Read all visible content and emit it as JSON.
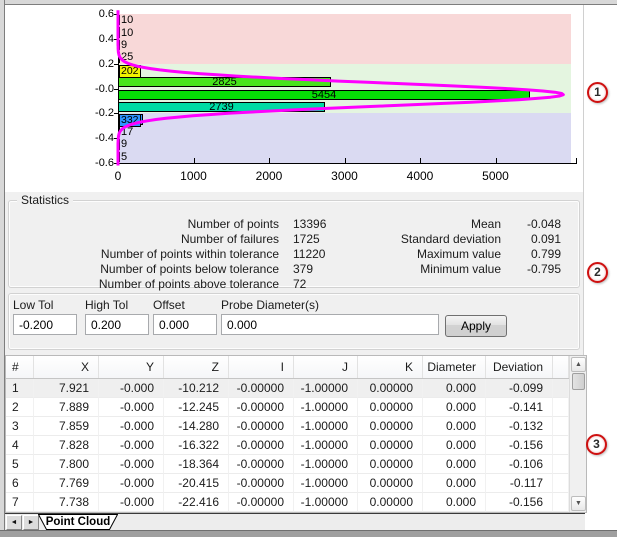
{
  "chart_data": {
    "type": "bar",
    "orientation": "horizontal-histogram",
    "title": "",
    "xlabel": "",
    "ylabel": "",
    "xlim": [
      0,
      6000
    ],
    "ylim": [
      -0.6,
      0.6
    ],
    "x_ticks": [
      0,
      1000,
      2000,
      3000,
      4000,
      5000
    ],
    "y_tick_labels": [
      "0.6",
      "0.4",
      "0.2",
      "-0.0",
      "-0.2",
      "-0.4",
      "-0.6"
    ],
    "bins": [
      {
        "range": [
          0.5,
          0.6
        ],
        "count": 10,
        "color": "#ffffff"
      },
      {
        "range": [
          0.4,
          0.5
        ],
        "count": 10,
        "color": "#ffffff"
      },
      {
        "range": [
          0.3,
          0.4
        ],
        "count": 9,
        "color": "#ffffff"
      },
      {
        "range": [
          0.2,
          0.3
        ],
        "count": 25,
        "color": "#ffffff"
      },
      {
        "range": [
          0.1,
          0.2
        ],
        "count": 202,
        "color": "#f2f200"
      },
      {
        "range": [
          0.0,
          0.1
        ],
        "count": 2825,
        "color": "#47e41c"
      },
      {
        "range": [
          -0.1,
          0.0
        ],
        "count": 5454,
        "color": "#06de06"
      },
      {
        "range": [
          -0.2,
          -0.1
        ],
        "count": 2739,
        "color": "#00dba4"
      },
      {
        "range": [
          -0.3,
          -0.2
        ],
        "count": 332,
        "color": "#2e93ff"
      },
      {
        "range": [
          -0.4,
          -0.3
        ],
        "count": 17,
        "color": "#ffffff"
      },
      {
        "range": [
          -0.5,
          -0.4
        ],
        "count": 9,
        "color": "#ffffff"
      },
      {
        "range": [
          -0.6,
          -0.5
        ],
        "count": 5,
        "color": "#ffffff"
      }
    ],
    "tolerance_bands": [
      {
        "meaning": "above-tolerance",
        "range": [
          0.2,
          0.6
        ],
        "color": "#f8d8d8"
      },
      {
        "meaning": "within-tolerance",
        "range": [
          -0.2,
          0.2
        ],
        "color": "#e4f5e0"
      },
      {
        "meaning": "below-tolerance",
        "range": [
          -0.6,
          -0.2
        ],
        "color": "#dadaf2"
      }
    ],
    "curve": {
      "shape": "gaussian",
      "mean": -0.048,
      "sigma": 0.091,
      "peak": 5900,
      "color": "#ff00ff"
    },
    "legend": null,
    "grid": false
  },
  "statistics": {
    "title": "Statistics",
    "left": [
      {
        "label": "Number of points",
        "value": "13396"
      },
      {
        "label": "Number of failures",
        "value": "1725"
      },
      {
        "label": "Number of points within tolerance",
        "value": "11220"
      },
      {
        "label": "Number of points below tolerance",
        "value": "379"
      },
      {
        "label": "Number of points above tolerance",
        "value": "72"
      }
    ],
    "right": [
      {
        "label": "Mean",
        "value": "-0.048"
      },
      {
        "label": "Standard deviation",
        "value": "0.091"
      },
      {
        "label": "Maximum value",
        "value": "0.799"
      },
      {
        "label": "Minimum value",
        "value": "-0.795"
      }
    ]
  },
  "tolerance": {
    "fields": [
      {
        "name": "low-tol",
        "label": "Low Tol",
        "value": "-0.200"
      },
      {
        "name": "high-tol",
        "label": "High Tol",
        "value": "0.200"
      },
      {
        "name": "offset",
        "label": "Offset",
        "value": "0.000"
      },
      {
        "name": "probe-diameter",
        "label": "Probe Diameter(s)",
        "value": "0.000"
      }
    ],
    "apply_label": "Apply"
  },
  "table": {
    "columns": [
      "#",
      "X",
      "Y",
      "Z",
      "I",
      "J",
      "K",
      "Diameter",
      "Deviation"
    ],
    "rows": [
      [
        "1",
        "7.921",
        "-0.000",
        "-10.212",
        "-0.00000",
        "-1.00000",
        "0.00000",
        "0.000",
        "-0.099"
      ],
      [
        "2",
        "7.889",
        "-0.000",
        "-12.245",
        "-0.00000",
        "-1.00000",
        "0.00000",
        "0.000",
        "-0.141"
      ],
      [
        "3",
        "7.859",
        "-0.000",
        "-14.280",
        "-0.00000",
        "-1.00000",
        "0.00000",
        "0.000",
        "-0.132"
      ],
      [
        "4",
        "7.828",
        "-0.000",
        "-16.322",
        "-0.00000",
        "-1.00000",
        "0.00000",
        "0.000",
        "-0.156"
      ],
      [
        "5",
        "7.800",
        "-0.000",
        "-18.364",
        "-0.00000",
        "-1.00000",
        "0.00000",
        "0.000",
        "-0.106"
      ],
      [
        "6",
        "7.769",
        "-0.000",
        "-20.415",
        "-0.00000",
        "-1.00000",
        "0.00000",
        "0.000",
        "-0.117"
      ],
      [
        "7",
        "7.738",
        "-0.000",
        "-22.416",
        "-0.00000",
        "-1.00000",
        "0.00000",
        "0.000",
        "-0.156"
      ]
    ],
    "scrollbar": {
      "up_icon": "▲",
      "down_icon": "▼"
    }
  },
  "tabbar": {
    "label": "Point Cloud",
    "prev_icon": "◄",
    "next_icon": "►"
  },
  "callouts": [
    {
      "label": "1"
    },
    {
      "label": "2"
    },
    {
      "label": "3"
    }
  ],
  "colors": {
    "dialog_bg": "#f0f0f0",
    "curve": "#ff00ff",
    "callout_ring": "#cf1010"
  }
}
